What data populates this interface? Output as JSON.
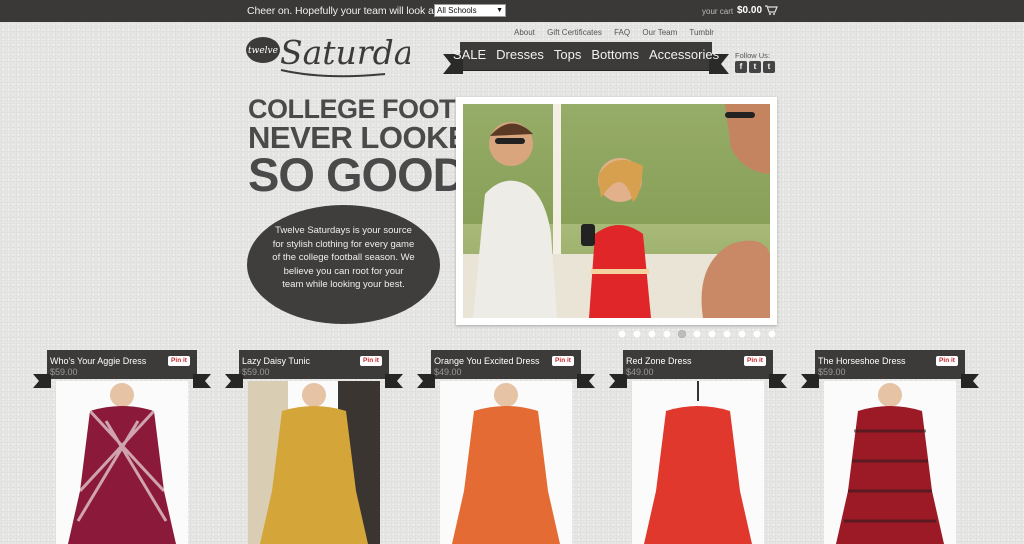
{
  "topbar": {
    "cheer_text": "Cheer on. Hopefully your team will look as good as you.",
    "school_select_value": "All Schools",
    "cart_label": "your cart",
    "cart_total": "$0.00"
  },
  "header": {
    "logo_small": "twelve",
    "logo_big": "Saturdays",
    "utility_nav": [
      "About",
      "Gift Certificates",
      "FAQ",
      "Our Team",
      "Tumblr"
    ],
    "main_nav": [
      "SALE",
      "Dresses",
      "Tops",
      "Bottoms",
      "Accessories"
    ],
    "follow_label": "Follow Us:",
    "social": [
      "f",
      "t",
      "t"
    ]
  },
  "hero": {
    "headline_1": "COLLEGE FOOTBALL",
    "headline_2": "NEVER LOOKED",
    "headline_3": "SO GOOD.",
    "blurb": "Twelve Saturdays is your source for stylish clothing for every game of the college football season. We believe you can root for your team while looking your best.",
    "slide_count": 11,
    "active_slide": 4
  },
  "products": [
    {
      "name": "Who's Your Aggie Dress",
      "price": "$59.00",
      "pin": "Pin it",
      "color": "#8b1a3a"
    },
    {
      "name": "Lazy Daisy Tunic",
      "price": "$59.00",
      "pin": "Pin it",
      "color": "#d4a63a"
    },
    {
      "name": "Orange You Excited Dress",
      "price": "$49.00",
      "pin": "Pin it",
      "color": "#e56b35"
    },
    {
      "name": "Red Zone Dress",
      "price": "$49.00",
      "pin": "Pin it",
      "color": "#e0382c"
    },
    {
      "name": "The Horseshoe Dress",
      "price": "$59.00",
      "pin": "Pin it",
      "color": "#9c1a26"
    }
  ]
}
